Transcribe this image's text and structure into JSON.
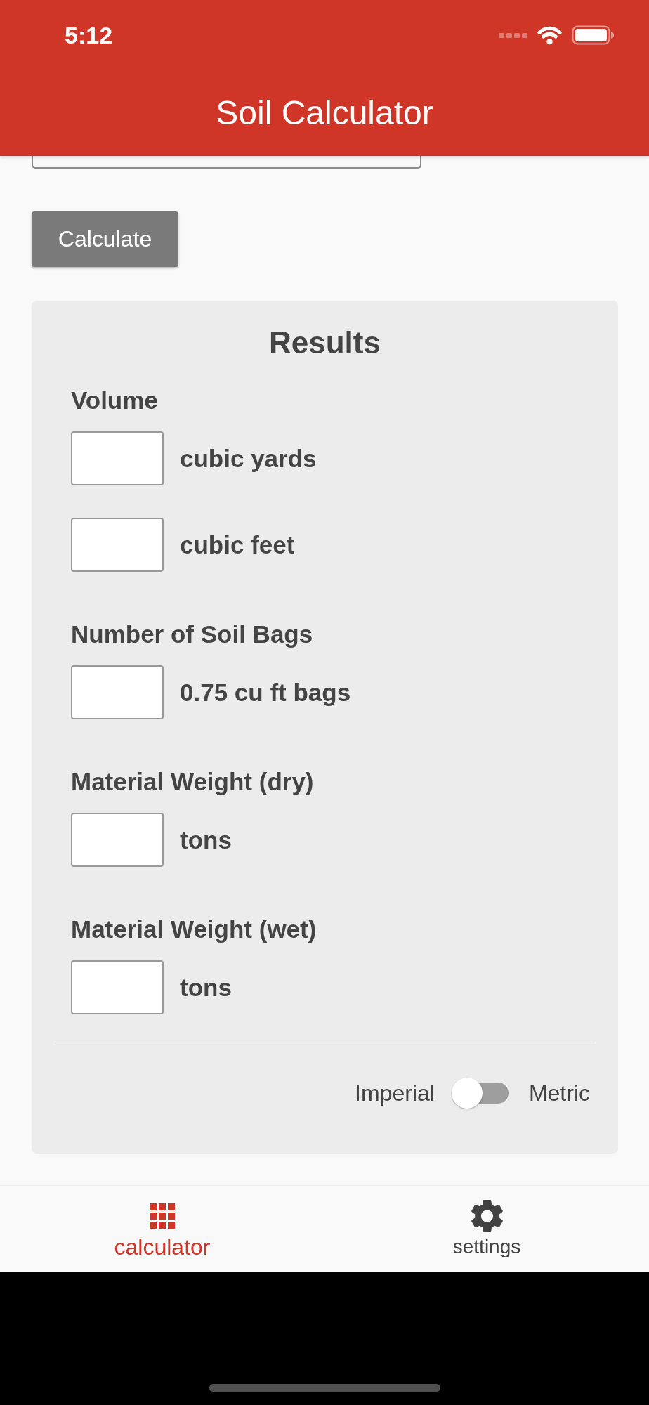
{
  "status_bar": {
    "time": "5:12"
  },
  "app_bar": {
    "title": "Soil Calculator"
  },
  "calculate_button": {
    "label": "Calculate"
  },
  "results": {
    "title": "Results",
    "sections": [
      {
        "label": "Volume",
        "fields": [
          {
            "unit": "cubic yards"
          },
          {
            "unit": "cubic feet"
          }
        ]
      },
      {
        "label": "Number of Soil Bags",
        "fields": [
          {
            "unit": "0.75 cu ft bags"
          }
        ]
      },
      {
        "label": "Material Weight (dry)",
        "fields": [
          {
            "unit": "tons"
          }
        ]
      },
      {
        "label": "Material Weight (wet)",
        "fields": [
          {
            "unit": "tons"
          }
        ]
      }
    ],
    "unit_toggle": {
      "left_label": "Imperial",
      "right_label": "Metric",
      "on": false
    }
  },
  "tabs": [
    {
      "label": "calculator",
      "selected": true
    },
    {
      "label": "settings",
      "selected": false
    }
  ]
}
